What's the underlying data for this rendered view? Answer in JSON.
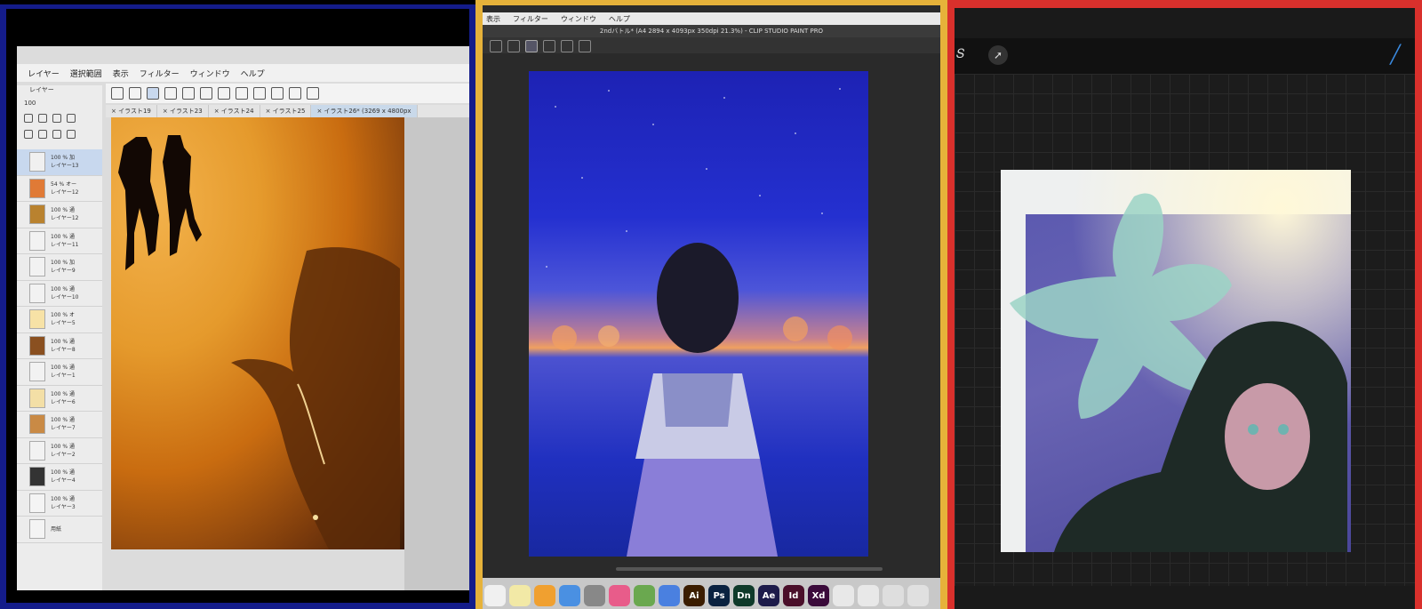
{
  "left_panel": {
    "menu": [
      "レイヤー",
      "選択範囲",
      "表示",
      "フィルター",
      "ウィンドウ",
      "ヘルプ"
    ],
    "layer_panel_title": "レイヤー",
    "opacity_value": "100",
    "tabs": [
      "× イラスト19",
      "× イラスト23",
      "× イラスト24",
      "× イラスト25",
      "× イラスト26* (3269 x 4800px"
    ],
    "layers": [
      {
        "line1": "100 % 加",
        "line2": "レイヤー13",
        "thumb": "#f0f0f0",
        "selected": true
      },
      {
        "line1": "54 % オー",
        "line2": "レイヤー12",
        "thumb": "#e07a36",
        "selected": false
      },
      {
        "line1": "100 % 通",
        "line2": "レイヤー12",
        "thumb": "#b9822f",
        "selected": false
      },
      {
        "line1": "100 % 通",
        "line2": "レイヤー11",
        "thumb": "#f2f2f2",
        "selected": false
      },
      {
        "line1": "100 % 加",
        "line2": "レイヤー9",
        "thumb": "#f2f2f2",
        "selected": false
      },
      {
        "line1": "100 % 通",
        "line2": "レイヤー10",
        "thumb": "#f2f2f2",
        "selected": false
      },
      {
        "line1": "100 % オ",
        "line2": "レイヤー5",
        "thumb": "#f7e2a6",
        "selected": false
      },
      {
        "line1": "100 % 通",
        "line2": "レイヤー8",
        "thumb": "#8a5020",
        "selected": false
      },
      {
        "line1": "100 % 通",
        "line2": "レイヤー1",
        "thumb": "#f2f2f2",
        "selected": false
      },
      {
        "line1": "100 % 通",
        "line2": "レイヤー6",
        "thumb": "#f3dfa6",
        "selected": false
      },
      {
        "line1": "100 % 通",
        "line2": "レイヤー7",
        "thumb": "#c98a45",
        "selected": false
      },
      {
        "line1": "100 % 通",
        "line2": "レイヤー2",
        "thumb": "#f2f2f2",
        "selected": false
      },
      {
        "line1": "100 % 通",
        "line2": "レイヤー4",
        "thumb": "#333333",
        "selected": false
      },
      {
        "line1": "100 % 通",
        "line2": "レイヤー3",
        "thumb": "#f4f4f4",
        "selected": false
      },
      {
        "line1": "",
        "line2": "用紙",
        "thumb": "#f4f4f4",
        "selected": false
      }
    ]
  },
  "mid_panel": {
    "menu": [
      "表示",
      "フィルター",
      "ウィンドウ",
      "ヘルプ"
    ],
    "title": "2ndバトル* (A4 2894 x 4093px 350dpi 21.3%) - CLIP STUDIO PAINT PRO",
    "dock": [
      {
        "label": "",
        "color": "#f0f0f0"
      },
      {
        "label": "",
        "color": "#f2e9a6"
      },
      {
        "label": "",
        "color": "#f0a030"
      },
      {
        "label": "",
        "color": "#4a90e2"
      },
      {
        "label": "",
        "color": "#888888"
      },
      {
        "label": "",
        "color": "#e85c8a"
      },
      {
        "label": "",
        "color": "#6aa84f"
      },
      {
        "label": "",
        "color": "#4a80e0"
      },
      {
        "label": "Ai",
        "color": "#3b1d00"
      },
      {
        "label": "Ps",
        "color": "#0a2240"
      },
      {
        "label": "Dn",
        "color": "#0f3a2a"
      },
      {
        "label": "Ae",
        "color": "#1d1b4a"
      },
      {
        "label": "Id",
        "color": "#4a0f2a"
      },
      {
        "label": "Xd",
        "color": "#3a0a3a"
      },
      {
        "label": "",
        "color": "#e8e8e8"
      },
      {
        "label": "",
        "color": "#e8e8e8"
      },
      {
        "label": "",
        "color": "#dedede"
      },
      {
        "label": "",
        "color": "#e0e0e0"
      }
    ]
  },
  "colors": {
    "left_border": "#141c8a",
    "mid_border": "#e6b23a",
    "right_border": "#d9302c",
    "procreate_brush_active": "#3a8ae0"
  }
}
